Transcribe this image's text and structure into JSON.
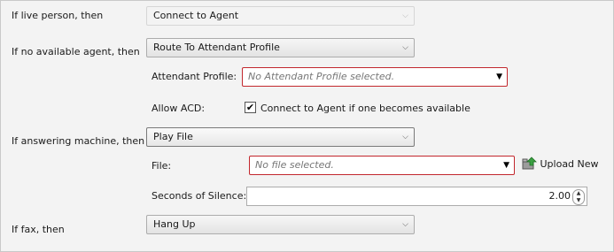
{
  "rows": {
    "live_person": {
      "label": "If live person, then",
      "value": "Connect to Agent"
    },
    "no_agent": {
      "label": "If no available agent, then",
      "value": "Route To Attendant Profile"
    },
    "attendant_profile": {
      "label": "Attendant Profile:",
      "placeholder": "No Attendant Profile selected."
    },
    "allow_acd": {
      "label": "Allow ACD:",
      "checked": true,
      "checkbox_label": "Connect to Agent if one becomes available"
    },
    "answering_machine": {
      "label": "If answering machine, then",
      "value": "Play File"
    },
    "file": {
      "label": "File:",
      "placeholder": "No file selected.",
      "upload_label": "Upload New"
    },
    "silence": {
      "label": "Seconds of Silence:",
      "value": "2.00"
    },
    "fax": {
      "label": "If fax, then",
      "value": "Hang Up"
    }
  },
  "icons": {
    "dropdown": "chevron-down-icon",
    "error_dropdown": "triangle-down-icon",
    "upload": "upload-folder-icon",
    "check": "checkmark-icon",
    "spin_up": "caret-up-icon",
    "spin_down": "caret-down-icon"
  },
  "colors": {
    "error_border": "#c2272d",
    "upload_icon": "#3aa041"
  }
}
